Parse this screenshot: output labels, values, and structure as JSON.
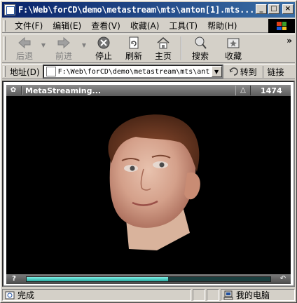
{
  "window": {
    "title": "F:\\Web\\forCD\\demo\\metastream\\mts\\anton[1].mts..."
  },
  "menu": {
    "items": [
      "文件(F)",
      "编辑(E)",
      "查看(V)",
      "收藏(A)",
      "工具(T)",
      "帮助(H)"
    ]
  },
  "toolbar": {
    "back": "后退",
    "forward": "前进",
    "stop": "停止",
    "refresh": "刷新",
    "home": "主页",
    "search": "搜索",
    "favorites": "收藏",
    "more": "»"
  },
  "address": {
    "label": "地址(D)",
    "url": "F:\\Web\\forCD\\demo\\metastream\\mts\\ant",
    "go": "转到",
    "links": "链接"
  },
  "player": {
    "title": "MetaStreaming...",
    "frame_count": "1474",
    "help": "?",
    "progress": 0.58
  },
  "status": {
    "text": "完成",
    "zone": "我的电脑"
  },
  "colors": {
    "titlebar_start": "#0a246a",
    "titlebar_end": "#3a6ea5",
    "progress": "#5fd8cf"
  }
}
